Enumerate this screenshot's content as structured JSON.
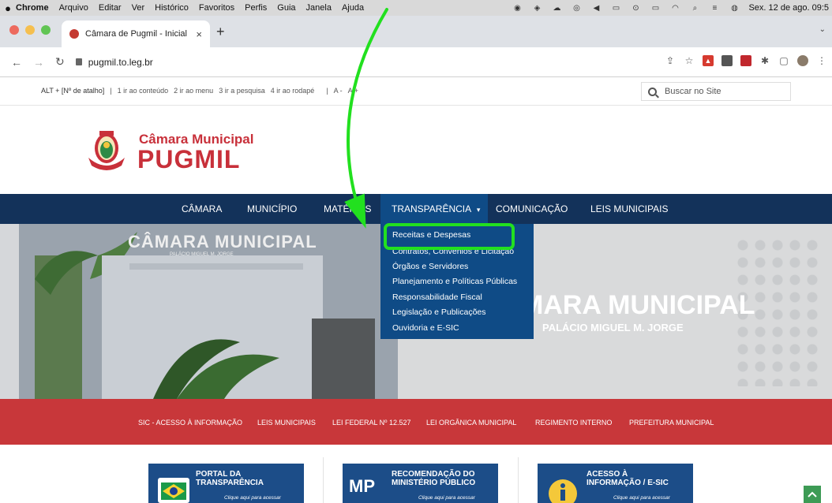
{
  "mac_menubar": {
    "apple": "",
    "app": "Chrome",
    "menus": [
      "Arquivo",
      "Editar",
      "Ver",
      "Histórico",
      "Favoritos",
      "Perfis",
      "Guia",
      "Janela",
      "Ajuda"
    ],
    "clock": "Sex. 12 de ago. 09:5"
  },
  "browser": {
    "tab_title": "Câmara de Pugmil - Inicial",
    "tab_close": "×",
    "new_tab": "+",
    "url": "pugmil.to.leg.br"
  },
  "accessibility": {
    "shortcut": "ALT + [Nº de atalho]",
    "links": [
      "1 ir ao conteúdo",
      "2 ir ao menu",
      "3 ir a pesquisa",
      "4 ir ao rodapé"
    ],
    "font_minus": "A -",
    "font_plus": "A +",
    "search_placeholder": "Buscar no Site"
  },
  "logo": {
    "line1": "Câmara Municipal",
    "line2": "PUGMIL"
  },
  "nav": {
    "items": [
      "CÂMARA",
      "MUNICÍPIO",
      "MATÉRIAS",
      "TRANSPARÊNCIA",
      "COMUNICAÇÃO",
      "LEIS MUNICIPAIS"
    ],
    "caret": "▾"
  },
  "dropdown": {
    "items": [
      "Receitas e Despesas",
      "Contratos, Convênios e Licitação",
      "Órgãos e Servidores",
      "Planejamento e Políticas Públicas",
      "Responsabilidade Fiscal",
      "Legislação e Publicações",
      "Ouvidoria e E-SIC"
    ]
  },
  "hero": {
    "left_title": "CÂMARA MUNICIPAL",
    "left_subtitle": "PALÁCIO MIGUEL M. JORGE",
    "right_title": "MARA MUNICIPAL",
    "right_subtitle": "PALÁCIO MIGUEL M. JORGE"
  },
  "quicklinks": [
    "SIC - ACESSO À INFORMAÇÃO",
    "LEIS MUNICIPAIS",
    "LEI FEDERAL Nº 12.527",
    "LEI ORGÂNICA MUNICIPAL",
    "REGIMENTO INTERNO",
    "PREFEITURA MUNICIPAL"
  ],
  "cards": [
    {
      "title1": "PORTAL DA",
      "title2": "TRANSPARÊNCIA",
      "cta": "Clique aqui para acessar"
    },
    {
      "title1": "RECOMENDAÇÃO DO",
      "title2": "MINISTÉRIO PÚBLICO",
      "badge": "MP",
      "cta": "Clique aqui para acessar"
    },
    {
      "title1": "ACESSO À",
      "title2": "INFORMAÇÃO / E-SIC",
      "cta": "Clique aqui para acessar"
    }
  ],
  "colors": {
    "nav_bg": "#13325a",
    "dropdown_bg": "#0f4b86",
    "brand_red": "#c8303a",
    "annotation_green": "#22e01f"
  }
}
